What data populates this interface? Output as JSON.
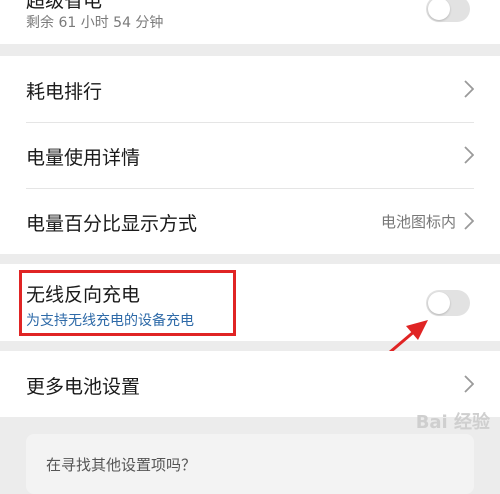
{
  "top_card": {
    "title": "超级省电",
    "subtitle": "剩余 61 小时 54 分钟",
    "toggle_on": false
  },
  "menu": [
    {
      "label": "耗电排行",
      "value": ""
    },
    {
      "label": "电量使用详情",
      "value": ""
    },
    {
      "label": "电量百分比显示方式",
      "value": "电池图标内"
    }
  ],
  "wireless": {
    "title": "无线反向充电",
    "subtitle": "为支持无线充电的设备充电",
    "toggle_on": false
  },
  "more": {
    "label": "更多电池设置"
  },
  "bottom": {
    "text": "在寻找其他设置项吗？"
  },
  "watermark": "Bai 经验",
  "colors": {
    "highlight": "#e02424",
    "subtitle_blue": "#2e6aa8",
    "background": "#ececec"
  }
}
